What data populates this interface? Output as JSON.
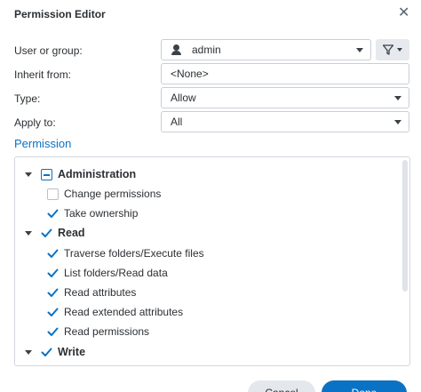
{
  "dialog": {
    "title": "Permission Editor"
  },
  "form": {
    "user_label": "User or group:",
    "user_value": "admin",
    "inherit_label": "Inherit from:",
    "inherit_value": "<None>",
    "type_label": "Type:",
    "type_value": "Allow",
    "apply_label": "Apply to:",
    "apply_value": "All"
  },
  "permission": {
    "title": "Permission",
    "groups": [
      {
        "label": "Administration",
        "state": "partial",
        "items": [
          {
            "label": "Change permissions",
            "checked": false
          },
          {
            "label": "Take ownership",
            "checked": true
          }
        ]
      },
      {
        "label": "Read",
        "state": "checked",
        "items": [
          {
            "label": "Traverse folders/Execute files",
            "checked": true
          },
          {
            "label": "List folders/Read data",
            "checked": true
          },
          {
            "label": "Read attributes",
            "checked": true
          },
          {
            "label": "Read extended attributes",
            "checked": true
          },
          {
            "label": "Read permissions",
            "checked": true
          }
        ]
      },
      {
        "label": "Write",
        "state": "checked",
        "items": []
      }
    ]
  },
  "footer": {
    "cancel_label": "Cancel",
    "done_label": "Done"
  },
  "colors": {
    "accent": "#0a72c4",
    "text": "#2b2f33",
    "border": "#c8ced6"
  }
}
